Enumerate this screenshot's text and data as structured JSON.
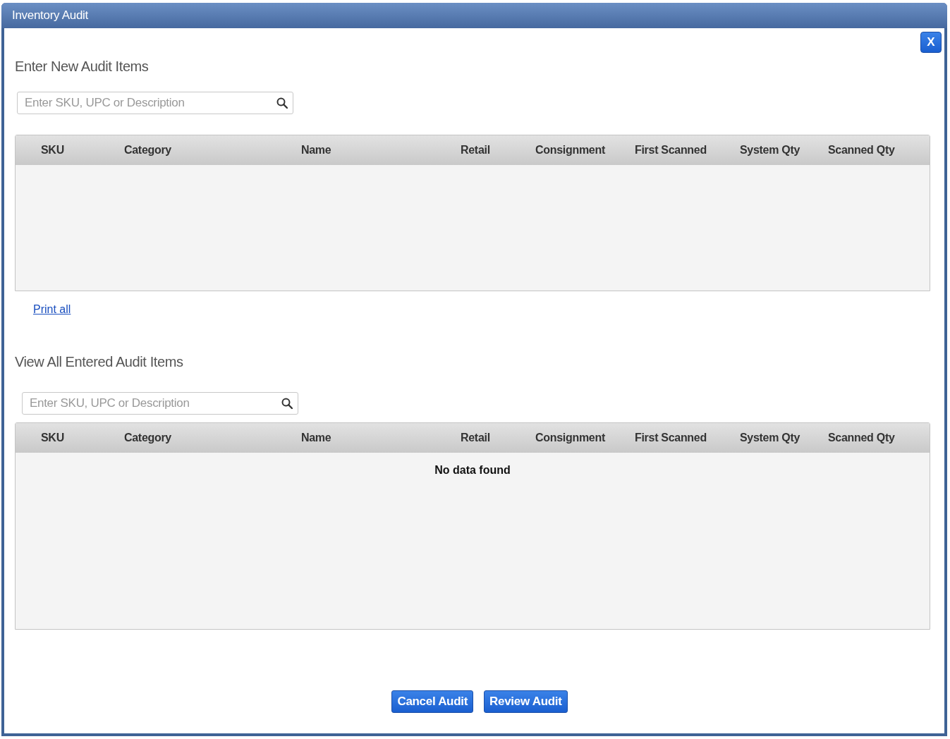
{
  "window": {
    "title": "Inventory Audit",
    "close_label": "X"
  },
  "sections": [
    {
      "heading": "Enter New Audit Items",
      "search": {
        "placeholder": "Enter SKU, UPC or Description"
      },
      "table": {
        "columns": [
          "SKU",
          "Category",
          "Name",
          "Retail",
          "Consignment",
          "First Scanned",
          "System Qty",
          "Scanned Qty"
        ]
      },
      "link": "Print all"
    },
    {
      "heading": "View All Entered Audit Items",
      "search": {
        "placeholder": "Enter SKU, UPC or Description"
      },
      "table": {
        "columns": [
          "SKU",
          "Category",
          "Name",
          "Retail",
          "Consignment",
          "First Scanned",
          "System Qty",
          "Scanned Qty"
        ],
        "empty_message": "No data found"
      }
    }
  ],
  "buttons": [
    "Cancel Audit",
    "Review Audit"
  ]
}
